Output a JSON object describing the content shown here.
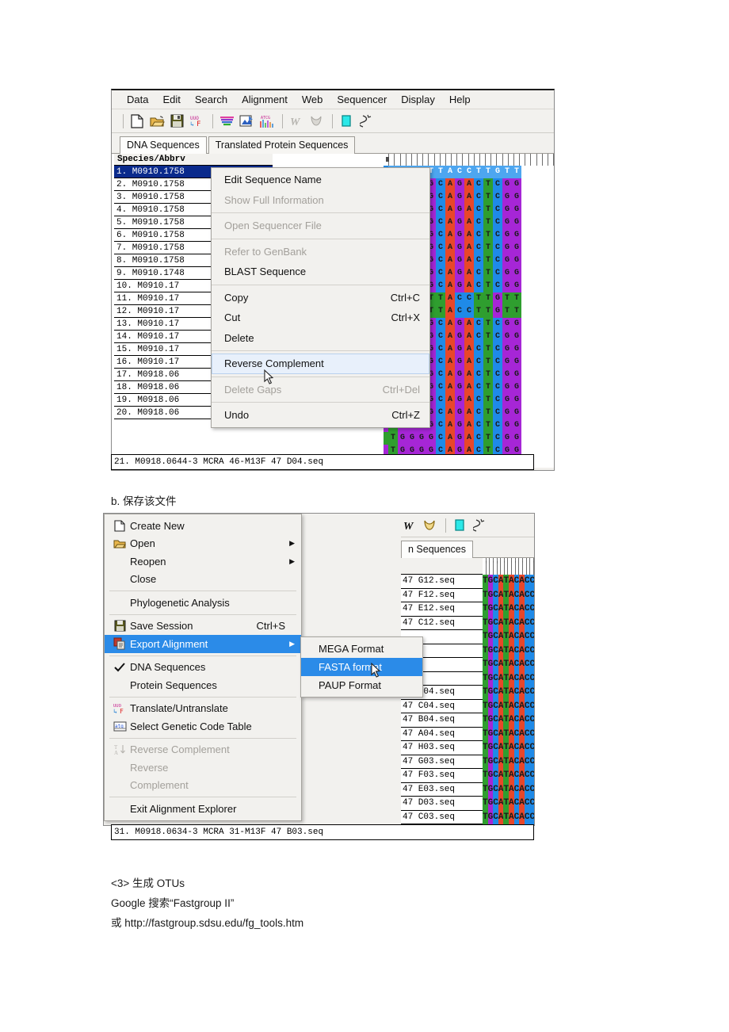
{
  "page": {
    "caption_b": "b. 保存该文件",
    "section3_title": "<3> 生成 OTUs",
    "section3_line2": "Google  搜索“Fastgroup II”",
    "section3_line3": "或  http://fastgroup.sdsu.edu/fg_tools.htm"
  },
  "shot1": {
    "menubar": [
      "Data",
      "Edit",
      "Search",
      "Alignment",
      "Web",
      "Sequencer",
      "Display",
      "Help"
    ],
    "toolbar_icons": [
      "new-file-icon",
      "open-folder-icon",
      "save-disk-icon",
      "translate-icon",
      "sep",
      "align-icon",
      "align-by-profile-icon",
      "trace-data-icon",
      "sep",
      "clustalw-icon",
      "muscle-icon",
      "sep",
      "marker-icon",
      "dna-toggle-icon"
    ],
    "tabs": [
      {
        "label": "DNA Sequences",
        "active": true
      },
      {
        "label": "Translated Protein Sequences",
        "active": false
      }
    ],
    "name_header": "Species/Abbrv",
    "rows": [
      "1.  M0910.1758",
      "2.  M0910.1758",
      "3.  M0910.1758",
      "4.  M0910.1758",
      "5.  M0910.1758",
      "6.  M0910.1758",
      "7.  M0910.1758",
      "8.  M0910.1758",
      "9.  M0910.1748",
      "10.  M0910.17",
      "11.  M0910.17",
      "12.  M0910.17",
      "13.  M0910.17",
      "14.  M0910.17",
      "15.  M0910.17",
      "16.  M0910.17",
      "17.  M0918.06",
      "18.  M0918.06",
      "19.  M0918.06",
      "20.  M0918.06"
    ],
    "bottom_row": "21.  M0918.0644-3 MCRA 46-M13F 47 D04.seq",
    "selected_row_index": 0,
    "header_seq": "GCCTTTACCTTGTT",
    "consensus_seq": "TGGGGCAGACTCGG",
    "odd_seq": "GCCTTTACCTTGTT",
    "context_menu": {
      "items": [
        {
          "label": "Edit Sequence Name",
          "accel": "",
          "state": "normal"
        },
        {
          "label": "Show Full Information",
          "accel": "",
          "state": "disabled"
        },
        {
          "sep": true
        },
        {
          "label": "Open Sequencer File",
          "accel": "",
          "state": "disabled"
        },
        {
          "sep": true
        },
        {
          "label": "Refer to GenBank",
          "accel": "",
          "state": "disabled"
        },
        {
          "label": "BLAST Sequence",
          "accel": "",
          "state": "normal"
        },
        {
          "sep": true
        },
        {
          "label": "Copy",
          "accel": "Ctrl+C",
          "state": "normal"
        },
        {
          "label": "Cut",
          "accel": "Ctrl+X",
          "state": "normal"
        },
        {
          "label": "Delete",
          "accel": "",
          "state": "normal"
        },
        {
          "sep": true
        },
        {
          "label": "Reverse Complement",
          "accel": "",
          "state": "highlighted"
        },
        {
          "sep": true
        },
        {
          "label": "Delete Gaps",
          "accel": "Ctrl+Del",
          "state": "disabled"
        },
        {
          "sep": true
        },
        {
          "label": "Undo",
          "accel": "Ctrl+Z",
          "state": "normal"
        }
      ]
    }
  },
  "shot2": {
    "toolbar_icons": [
      "clustalw-icon",
      "muscle-icon",
      "sep",
      "marker-icon",
      "dna-toggle-icon"
    ],
    "tab_label": "n Sequences",
    "data_menu": {
      "items": [
        {
          "label": "Create New",
          "icon": "new-file-icon",
          "accel": "",
          "arrow": false,
          "state": "normal"
        },
        {
          "label": "Open",
          "icon": "open-folder-icon",
          "accel": "",
          "arrow": true,
          "state": "normal"
        },
        {
          "label": "Reopen",
          "icon": "",
          "accel": "",
          "arrow": true,
          "state": "normal"
        },
        {
          "label": "Close",
          "icon": "",
          "accel": "",
          "arrow": false,
          "state": "normal"
        },
        {
          "sep": true
        },
        {
          "label": "Phylogenetic Analysis",
          "icon": "",
          "accel": "",
          "arrow": false,
          "state": "normal"
        },
        {
          "sep": true
        },
        {
          "label": "Save Session",
          "icon": "save-disk-icon",
          "accel": "Ctrl+S",
          "arrow": false,
          "state": "normal"
        },
        {
          "label": "Export Alignment",
          "icon": "export-icon",
          "accel": "",
          "arrow": true,
          "state": "selected"
        },
        {
          "sep": true
        },
        {
          "label": "DNA Sequences",
          "icon": "check-icon",
          "accel": "",
          "arrow": false,
          "state": "normal"
        },
        {
          "label": "Protein Sequences",
          "icon": "",
          "accel": "",
          "arrow": false,
          "state": "normal"
        },
        {
          "sep": true
        },
        {
          "label": "Translate/Untranslate",
          "icon": "translate-icon",
          "accel": "",
          "arrow": false,
          "state": "normal"
        },
        {
          "label": "Select Genetic Code Table",
          "icon": "genetic-code-icon",
          "accel": "",
          "arrow": false,
          "state": "normal"
        },
        {
          "sep": true
        },
        {
          "label": "Reverse Complement",
          "icon": "revcomp-icon",
          "accel": "",
          "arrow": false,
          "state": "disabled"
        },
        {
          "label": "Reverse",
          "icon": "",
          "accel": "",
          "arrow": false,
          "state": "disabled"
        },
        {
          "label": "Complement",
          "icon": "",
          "accel": "",
          "arrow": false,
          "state": "disabled"
        },
        {
          "sep": true
        },
        {
          "label": "Exit Alignment Explorer",
          "icon": "",
          "accel": "",
          "arrow": false,
          "state": "normal"
        }
      ]
    },
    "submenu": {
      "items": [
        {
          "label": "MEGA Format",
          "state": "normal"
        },
        {
          "label": "FASTA format",
          "state": "selected"
        },
        {
          "label": "PAUP Format",
          "state": "normal"
        }
      ]
    },
    "rows": [
      "47 G12.seq",
      "47 F12.seq",
      "47 E12.seq",
      "47 C12.seq",
      "",
      "",
      "",
      "",
      "47 D04.seq",
      "47 C04.seq",
      "47 B04.seq",
      "47 A04.seq",
      "47 H03.seq",
      "47 G03.seq",
      "47 F03.seq",
      "47 E03.seq",
      "47 D03.seq",
      "47 C03.seq"
    ],
    "bottom_row": "31.  M0918.0634-3 MCRA 31-M13F 47 B03.seq",
    "seq_pattern": "TGCATACACCGATGACATC",
    "ruler_mark": "*"
  },
  "colors": {
    "nt_A": "#e8472a",
    "nt_T": "#2f9e2f",
    "nt_C": "#1f8ae8",
    "nt_G": "#a626d6",
    "highlight_blue": "#2b8be8",
    "selected_row_blue": "#0a2a8c",
    "menu_bg": "#f2f1ee",
    "disabled_text": "#a3a09b"
  }
}
